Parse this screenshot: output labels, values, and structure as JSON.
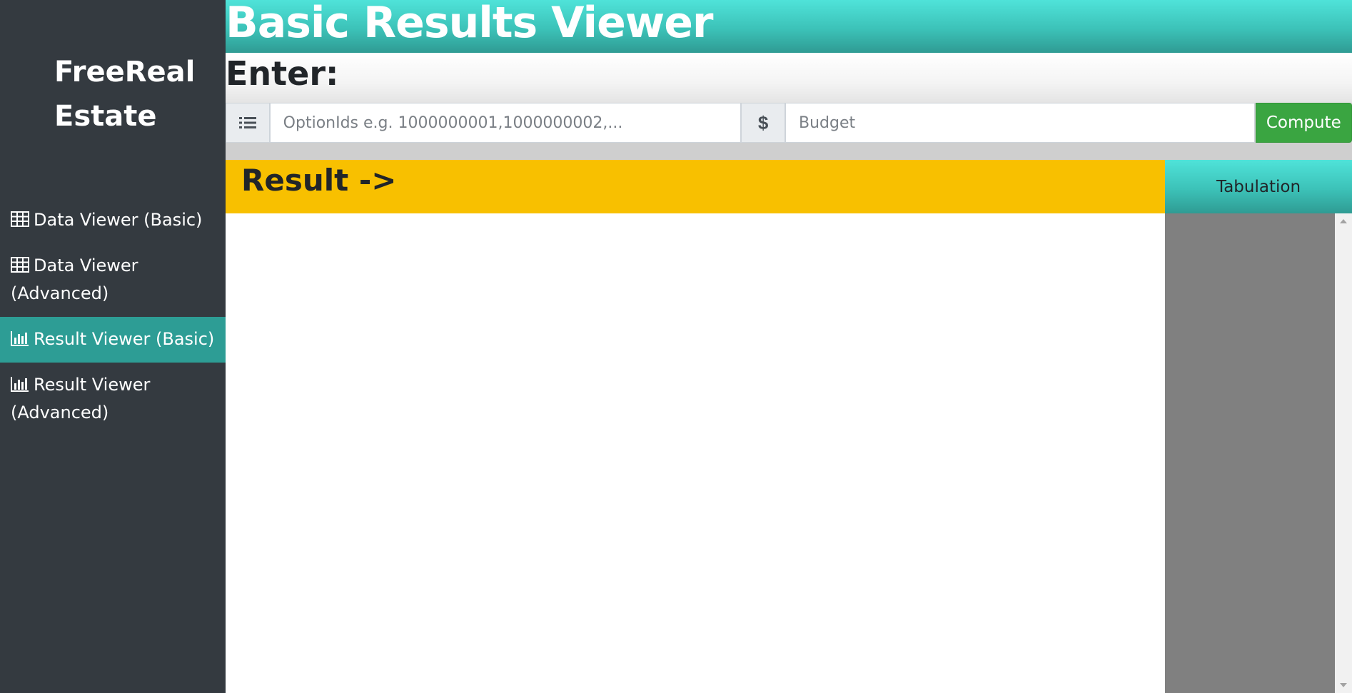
{
  "sidebar": {
    "brand": "FreeReal Estate",
    "items": [
      {
        "label": "Data Viewer (Basic)",
        "icon": "table-icon",
        "active": false
      },
      {
        "label": "Data Viewer (Advanced)",
        "icon": "table-icon",
        "active": false
      },
      {
        "label": "Result Viewer (Basic)",
        "icon": "bar-chart-icon",
        "active": true
      },
      {
        "label": "Result Viewer (Advanced)",
        "icon": "bar-chart-icon",
        "active": false
      }
    ]
  },
  "header": {
    "title": "Basic Results Viewer"
  },
  "form": {
    "enter_label": "Enter:",
    "options_icon": "list-icon",
    "options_placeholder": "OptionIds e.g. 1000000001,1000000002,...",
    "options_value": "",
    "currency_symbol": "$",
    "budget_placeholder": "Budget",
    "budget_value": "",
    "compute_label": "Compute"
  },
  "result": {
    "title": "Result ->"
  },
  "tabulation": {
    "label": "Tabulation"
  },
  "colors": {
    "sidebar": "#343a40",
    "active_nav": "#2d9d95",
    "header_teal": "#4fe3d9",
    "result_yellow": "#f8c000",
    "compute_green": "#3aa541",
    "tab_panel_gray": "#808080"
  }
}
